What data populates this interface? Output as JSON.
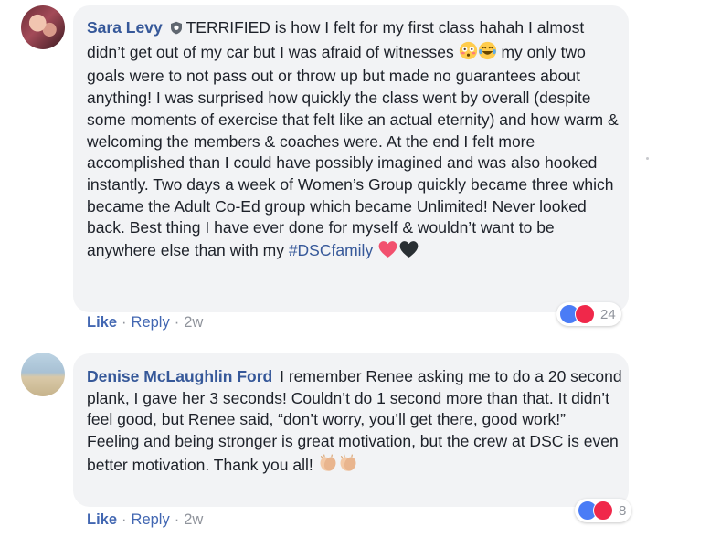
{
  "comments": [
    {
      "author": "Sara Levy",
      "text_part1": "TERRIFIED is how I felt for my first class hahah I almost didn’t get out of my car but I was afraid of witnesses ",
      "text_part2": " my only two goals were to not pass out or throw up but made no guarantees about anything! I was surprised how quickly the class went by overall (despite some moments of exercise that felt like an actual eternity) and how warm & welcoming the members & coaches were. At the end I felt more accomplished than I could have possibly imagined and was also hooked instantly. Two days a week of Women’s Group quickly became three which became the Adult Co-Ed group which became Unlimited! Never looked back. Best thing I have ever done for myself & wouldn’t want to be anywhere else than with my ",
      "hashtag": "#DSCfamily",
      "emojis": [
        "flushed-face",
        "tears-of-joy-face",
        "red-heart",
        "black-heart"
      ],
      "badge_icon": "shield-icon",
      "like_label": "Like",
      "reply_label": "Reply",
      "time": "2w",
      "reactions": {
        "icons": [
          "like",
          "love"
        ],
        "count": "24"
      }
    },
    {
      "author": "Denise McLaughlin Ford",
      "text": "I remember Renee asking me to do a 20 second plank, I gave her 3 seconds! Couldn’t do 1 second more than that. It didn’t feel good, but Renee said, “don’t worry, you’ll get there, good work!” Feeling and being stronger is great motivation, but the crew at DSC is even better motivation. Thank you all! ",
      "emojis": [
        "clapping-hands",
        "clapping-hands"
      ],
      "like_label": "Like",
      "reply_label": "Reply",
      "time": "2w",
      "reactions": {
        "icons": [
          "like",
          "love"
        ],
        "count": "8"
      }
    }
  ],
  "colors": {
    "link": "#365899",
    "action": "#4267b2",
    "muted": "#90949c",
    "bubble": "#f2f3f5",
    "like": "#4a7cf6",
    "love": "#f0284a"
  },
  "separator": "·"
}
